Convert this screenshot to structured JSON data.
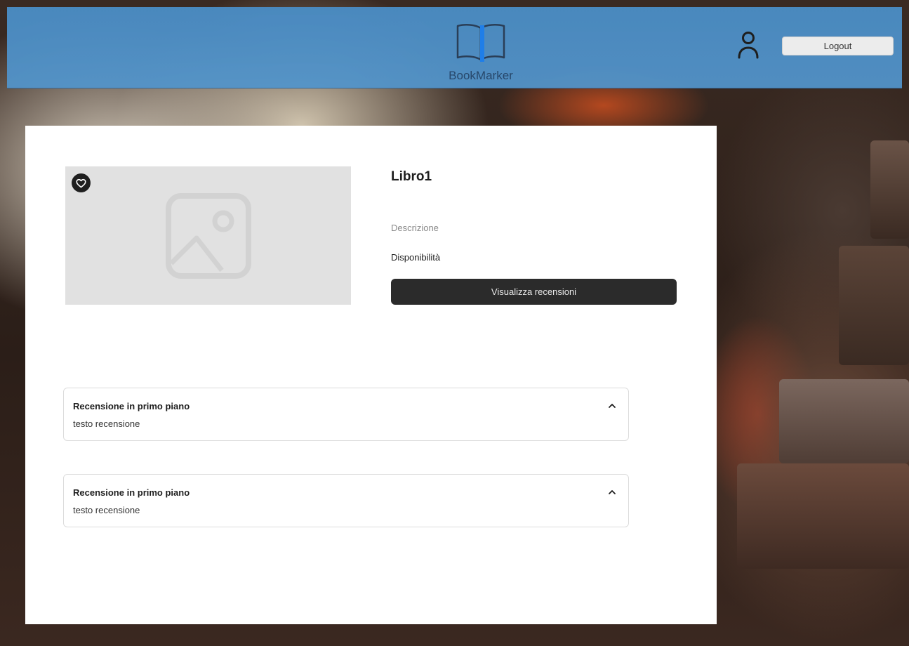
{
  "header": {
    "app_name": "BookMarker",
    "logout_label": "Logout",
    "logo_icon": "open-book-icon",
    "user_icon": "user-icon",
    "bar_color": "#4a8cc4"
  },
  "book": {
    "title": "Libro1",
    "description": "Descrizione",
    "availability": "Disponibilità",
    "view_reviews_label": "Visualizza recensioni",
    "favorite_icon": "heart-icon",
    "cover_placeholder_icon": "image-placeholder-icon"
  },
  "reviews": [
    {
      "title": "Recensione in primo piano",
      "text": "testo recensione",
      "icon": "chevron-up-icon"
    },
    {
      "title": "Recensione in primo piano",
      "text": "testo recensione",
      "icon": "chevron-up-icon"
    }
  ]
}
